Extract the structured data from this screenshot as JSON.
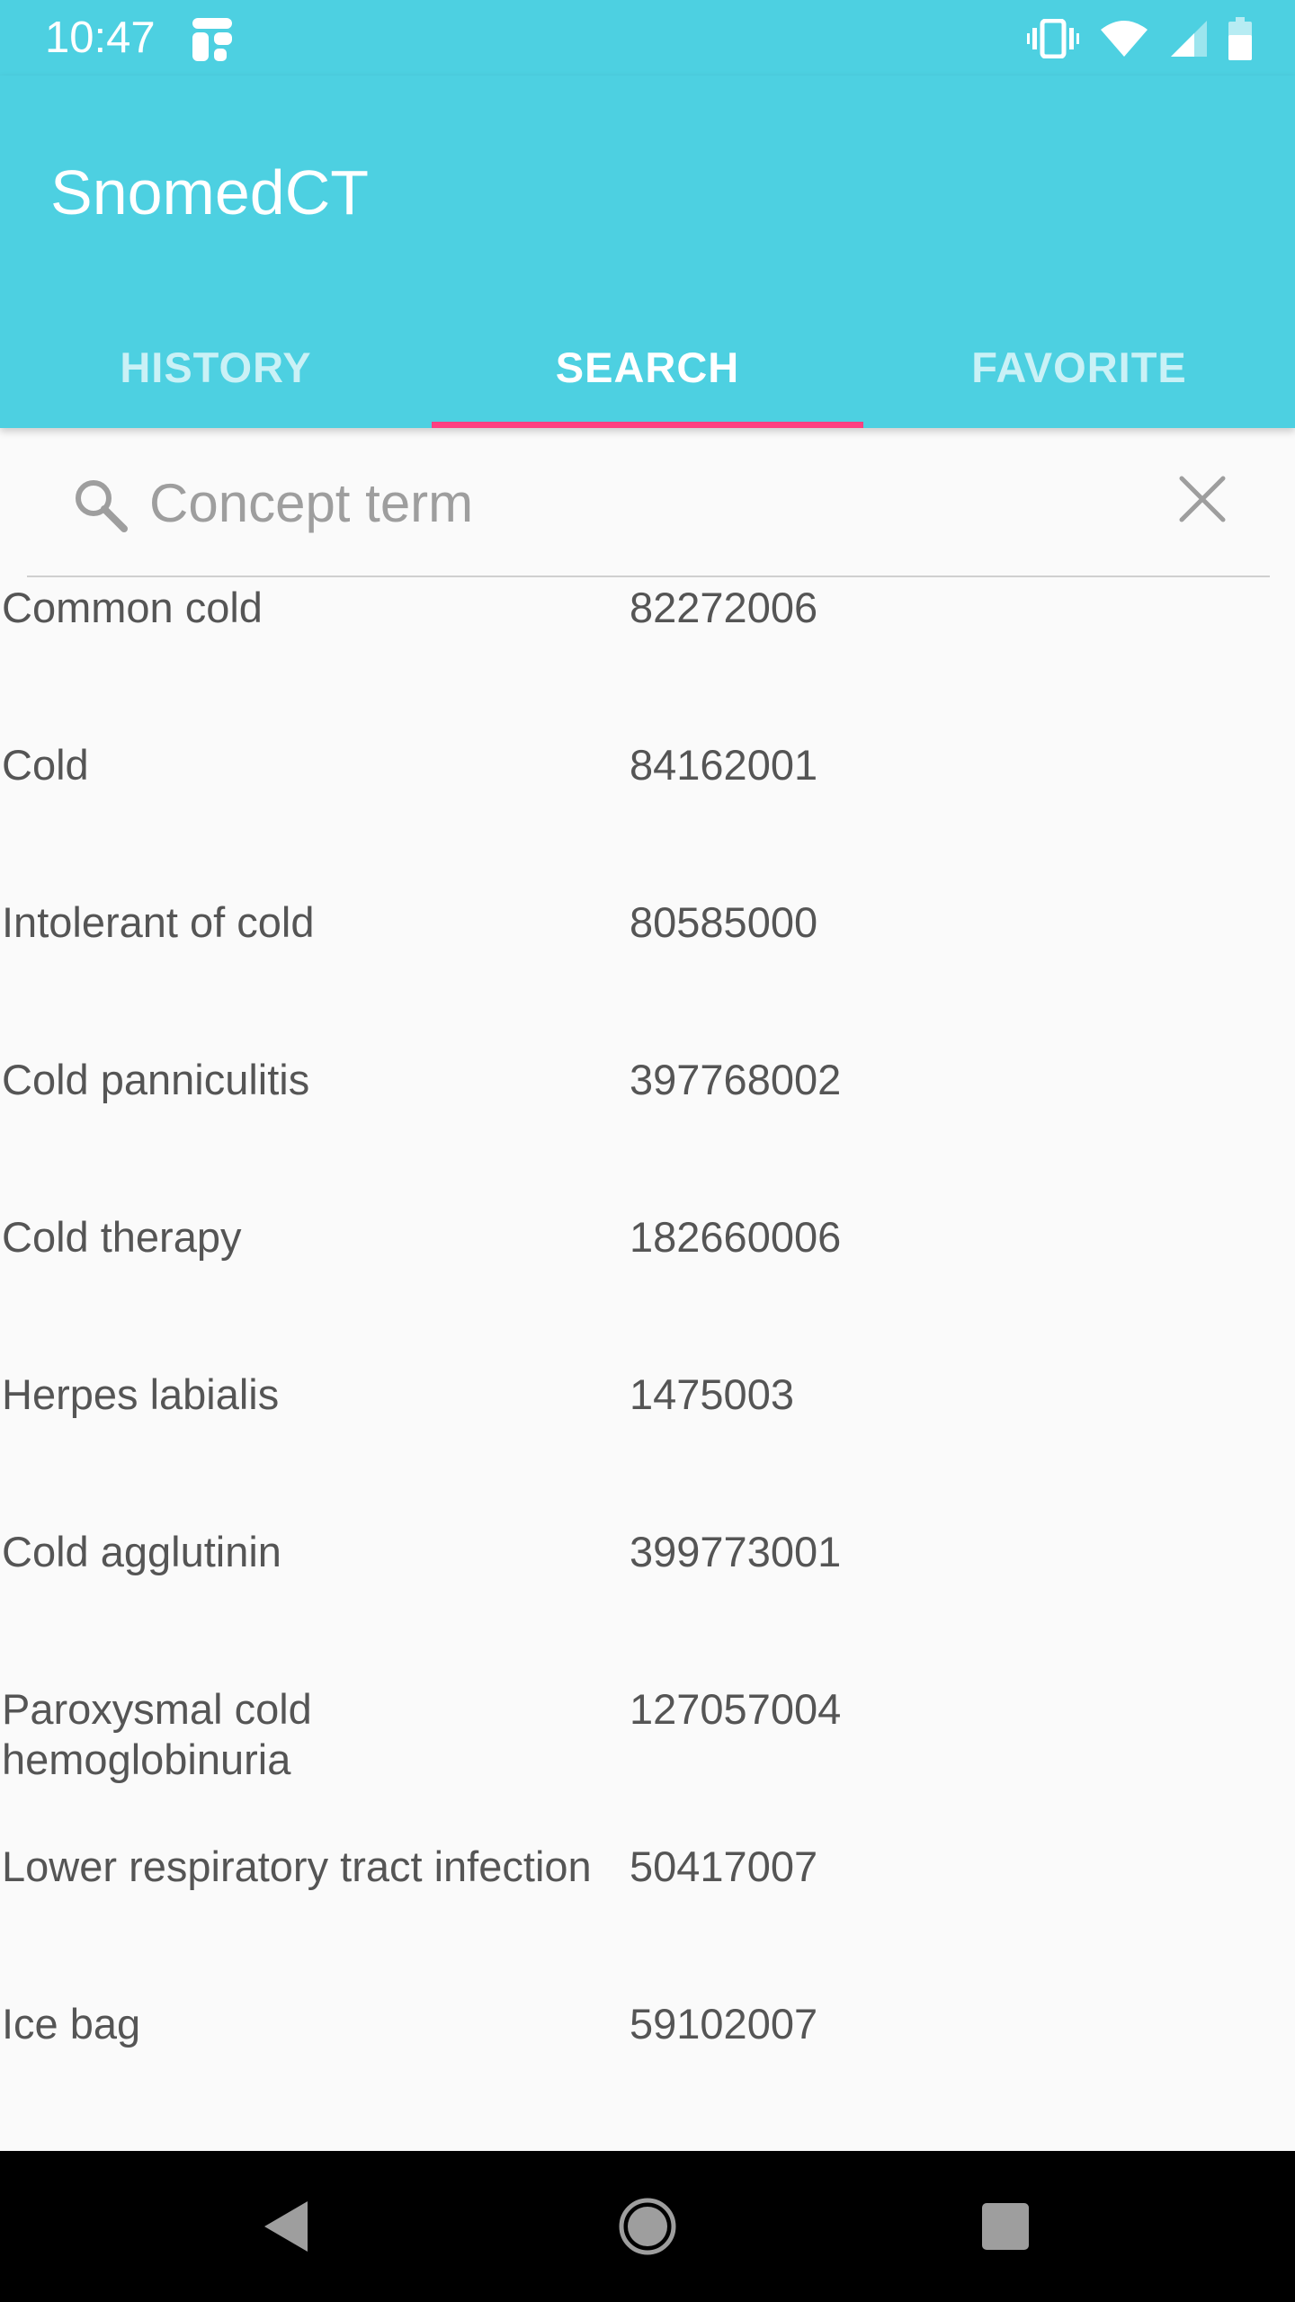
{
  "status_bar": {
    "time": "10:47",
    "icons": [
      "app-notification-icon",
      "vibrate-icon",
      "wifi-icon",
      "cell-signal-icon",
      "battery-icon"
    ]
  },
  "app_bar": {
    "title": "SnomedCT",
    "background_color": "#4dd0e1",
    "indicator_color": "#ff4081"
  },
  "tabs": [
    {
      "label": "HISTORY",
      "active": false
    },
    {
      "label": "SEARCH",
      "active": true
    },
    {
      "label": "FAVORITE",
      "active": false
    }
  ],
  "search": {
    "placeholder": "Concept term",
    "value": ""
  },
  "results": [
    {
      "term": "Common cold",
      "code": "82272006"
    },
    {
      "term": "Cold",
      "code": "84162001"
    },
    {
      "term": "Intolerant of cold",
      "code": "80585000"
    },
    {
      "term": "Cold panniculitis",
      "code": "397768002"
    },
    {
      "term": "Cold therapy",
      "code": "182660006"
    },
    {
      "term": "Herpes labialis",
      "code": "1475003"
    },
    {
      "term": "Cold agglutinin",
      "code": "399773001"
    },
    {
      "term": "Paroxysmal cold hemoglobinuria",
      "code": "127057004"
    },
    {
      "term": "Lower respiratory tract infection",
      "code": "50417007"
    },
    {
      "term": "Ice bag",
      "code": "59102007"
    }
  ],
  "nav_bar": {
    "icons": [
      "back-icon",
      "home-icon",
      "recents-icon"
    ]
  }
}
